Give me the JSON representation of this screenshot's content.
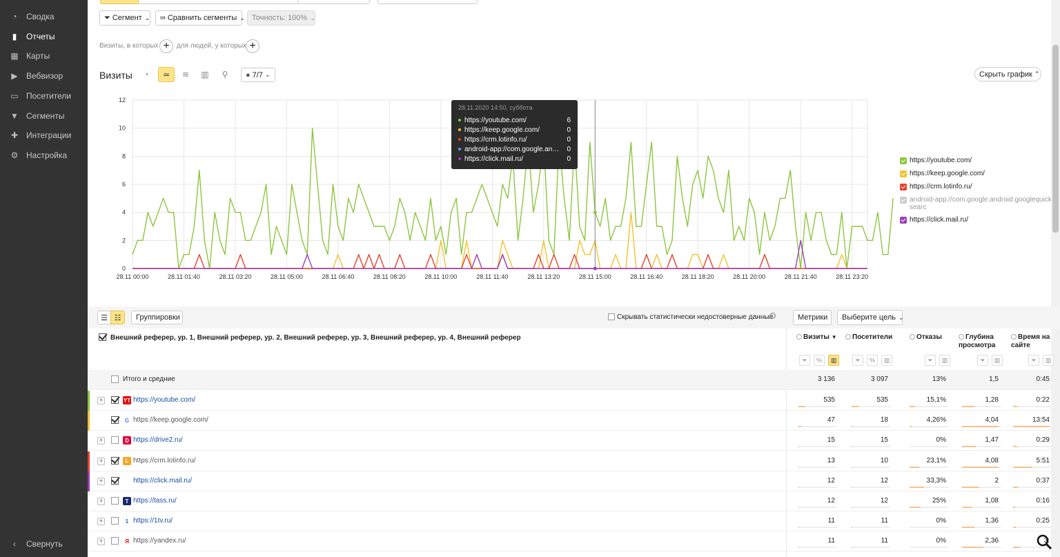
{
  "sidebar": {
    "items": [
      {
        "label": "Сводка",
        "icon": "gauge-icon",
        "active": false
      },
      {
        "label": "Отчеты",
        "icon": "bar-chart-icon",
        "active": true
      },
      {
        "label": "Карты",
        "icon": "map-icon",
        "active": false
      },
      {
        "label": "Вебвизор",
        "icon": "play-icon",
        "active": false
      },
      {
        "label": "Посетители",
        "icon": "visitors-icon",
        "active": false
      },
      {
        "label": "Сегменты",
        "icon": "funnel-icon",
        "active": false
      },
      {
        "label": "Интеграции",
        "icon": "puzzle-icon",
        "active": false
      },
      {
        "label": "Настройка",
        "icon": "gear-icon",
        "active": false
      }
    ],
    "collapse_label": "Свернуть"
  },
  "toolbar": {
    "segment_label": "Сегмент",
    "compare_label": "Сравнить сегменты",
    "accuracy_label": "Точность: 100%",
    "filter_visits_label": "Визиты, в которых",
    "filter_people_label": "для людей, у которых"
  },
  "chart_panel": {
    "title": "Визиты",
    "series_counter": "7/7",
    "hide_chart_label": "Скрыть график"
  },
  "tooltip": {
    "header": "28.11.2020 14:50, суббота",
    "rows": [
      {
        "label": "https://youtube.com/",
        "value": "6",
        "color": "#8cc63f"
      },
      {
        "label": "https://keep.google.com/",
        "value": "0",
        "color": "#f2c230"
      },
      {
        "label": "https://crm.lotinfo.ru/",
        "value": "0",
        "color": "#e8412c"
      },
      {
        "label": "android-app://com.google.andr...",
        "value": "0",
        "color": "#5aa0e0"
      },
      {
        "label": "https://click.mail.ru/",
        "value": "0",
        "color": "#9b3fb5"
      }
    ]
  },
  "legend": [
    {
      "label": "https://youtube.com/",
      "color": "#8cc63f"
    },
    {
      "label": "https://keep.google.com/",
      "color": "#f2c230"
    },
    {
      "label": "https://crm.lotinfo.ru/",
      "color": "#e8412c"
    },
    {
      "label": "android-app://com.google.android.googlequicksearc",
      "color": "#cccccc",
      "muted": true
    },
    {
      "label": "https://click.mail.ru/",
      "color": "#9b3fb5"
    }
  ],
  "chart_data": {
    "type": "line",
    "x_ticks": [
      "28.11 00:00",
      "28.11 01:40",
      "28.11 03:20",
      "28.11 05:00",
      "28.11 06:40",
      "28.11 08:20",
      "28.11 10:00",
      "28.11 11:40",
      "28.11 13:20",
      "28.11 15:00",
      "28.11 16:40",
      "28.11 18:20",
      "28.11 20:00",
      "28.11 21:40",
      "28.11 23:20"
    ],
    "ylim": [
      0,
      12
    ],
    "y_ticks": [
      0,
      2,
      4,
      6,
      8,
      10,
      12
    ],
    "x_count": 144,
    "series": [
      {
        "name": "https://youtube.com/",
        "color": "#8cc63f",
        "values": [
          1,
          2,
          2,
          4,
          3,
          4,
          5,
          4,
          4,
          0,
          1,
          1,
          3,
          7,
          2,
          0,
          4,
          2,
          1,
          5,
          4,
          4,
          2,
          2,
          3,
          4,
          6,
          1,
          3,
          2,
          1,
          6,
          4,
          2,
          1,
          10,
          6,
          2,
          1,
          6,
          3,
          2,
          5,
          4,
          6,
          5,
          4,
          3,
          3,
          3,
          2,
          3,
          5,
          4,
          2,
          4,
          3,
          2,
          5,
          2,
          3,
          1,
          4,
          5,
          1,
          4,
          4,
          5,
          6,
          5,
          4,
          3,
          6,
          5,
          8,
          2,
          5,
          9,
          4,
          6,
          9,
          2,
          1,
          9,
          5,
          2,
          9,
          3,
          2,
          9,
          4,
          3,
          5,
          2,
          3,
          3,
          5,
          9,
          3,
          3,
          6,
          9,
          3,
          3,
          1,
          2,
          8,
          5,
          3,
          6,
          7,
          5,
          8,
          7,
          5,
          4,
          7,
          2,
          3,
          2,
          5,
          4,
          1,
          4,
          2,
          3,
          5,
          5,
          7,
          3,
          0,
          4,
          2,
          4,
          4,
          2,
          1,
          1,
          4,
          0,
          3,
          3,
          3,
          2,
          2,
          4,
          1,
          1,
          5
        ]
      },
      {
        "name": "https://keep.google.com/",
        "color": "#f2c230",
        "values": [
          0,
          0,
          0,
          0,
          0,
          0,
          0,
          0,
          0,
          0,
          0,
          0,
          0,
          0,
          0,
          0,
          0,
          0,
          0,
          0,
          0,
          0,
          0,
          0,
          0,
          0,
          0,
          0,
          0,
          0,
          0,
          0,
          0,
          0,
          0,
          0,
          0,
          0,
          0,
          0,
          1,
          0,
          0,
          0,
          0,
          0,
          0,
          0,
          0,
          0,
          0,
          0,
          0,
          0,
          0,
          0,
          0,
          0,
          0,
          0,
          2,
          0,
          0,
          0,
          0,
          2,
          0,
          0,
          0,
          0,
          0,
          0,
          2,
          1,
          0,
          0,
          0,
          0,
          0,
          0,
          2,
          0,
          0,
          0,
          0,
          0,
          0,
          2,
          1,
          1,
          2,
          0,
          0,
          0,
          1,
          0,
          0,
          4,
          0,
          0,
          0,
          0,
          1,
          0,
          0,
          0,
          0,
          0,
          0,
          1,
          1,
          0,
          0,
          0,
          0,
          1,
          0,
          0,
          0,
          0,
          0,
          0,
          0,
          0,
          0,
          0,
          0,
          0,
          0,
          0,
          0,
          0,
          0,
          0,
          0,
          0,
          0,
          0,
          1,
          0,
          0,
          0,
          0,
          0
        ]
      },
      {
        "name": "https://crm.lotinfo.ru/",
        "color": "#e8412c",
        "values": [
          0,
          0,
          0,
          0,
          0,
          0,
          0,
          0,
          0,
          0,
          0,
          0,
          0,
          1,
          0,
          0,
          0,
          0,
          0,
          0,
          0,
          1,
          0,
          0,
          0,
          0,
          0,
          0,
          0,
          0,
          0,
          0,
          0,
          0,
          0,
          0,
          0,
          0,
          0,
          0,
          0,
          0,
          0,
          0,
          1,
          0,
          1,
          0,
          1,
          0,
          0,
          0,
          1,
          0,
          0,
          0,
          0,
          0,
          1,
          0,
          0,
          0,
          0,
          0,
          0,
          1,
          0,
          0,
          0,
          0,
          0,
          0,
          1,
          0,
          0,
          0,
          0,
          0,
          0,
          1,
          0,
          0,
          1,
          0,
          0,
          0,
          1,
          0,
          0,
          0,
          0,
          0,
          0,
          0,
          0,
          0,
          0,
          0,
          0,
          0,
          1,
          0,
          0,
          0,
          0,
          1,
          0,
          0,
          0,
          0,
          0,
          0,
          1,
          0,
          0,
          0,
          0,
          0,
          0,
          0,
          0,
          0,
          0,
          1,
          0,
          0,
          0,
          0,
          0,
          0,
          0,
          0,
          0,
          0,
          0,
          0,
          0,
          0,
          0,
          0,
          0,
          0,
          0,
          0
        ]
      },
      {
        "name": "https://click.mail.ru/",
        "color": "#9b3fb5",
        "values": [
          0,
          0,
          0,
          0,
          0,
          0,
          0,
          0,
          0,
          0,
          0,
          0,
          0,
          0,
          0,
          0,
          0,
          0,
          0,
          0,
          0,
          0,
          0,
          0,
          0,
          0,
          0,
          0,
          0,
          0,
          0,
          0,
          0,
          0,
          1,
          0,
          0,
          0,
          0,
          0,
          0,
          0,
          0,
          0,
          0,
          0,
          0,
          0,
          0,
          0,
          0,
          0,
          0,
          0,
          0,
          0,
          0,
          0,
          0,
          0,
          0,
          0,
          0,
          0,
          0,
          0,
          0,
          1,
          0,
          0,
          0,
          0,
          1,
          0,
          0,
          0,
          0,
          0,
          0,
          0,
          0,
          0,
          0,
          0,
          0,
          0,
          0,
          0,
          0,
          0,
          0,
          0,
          0,
          0,
          0,
          0,
          0,
          0,
          0,
          0,
          0,
          0,
          0,
          0,
          0,
          0,
          0,
          0,
          0,
          0,
          0,
          0,
          0,
          0,
          0,
          0,
          0,
          0,
          0,
          0,
          0,
          0,
          0,
          0,
          0,
          0,
          0,
          0,
          0,
          0,
          2,
          0,
          0,
          0,
          0,
          0,
          0,
          0,
          0,
          0,
          0,
          0,
          0,
          0
        ]
      }
    ]
  },
  "table_toolbar": {
    "groupings_label": "Группировки",
    "hide_unreliable_label": "Скрывать статистически недостоверные данные",
    "metrics_label": "Метрики",
    "goal_label": "Выберите цель"
  },
  "table": {
    "dimension_header": "Внешний реферер, ур. 1, Внешний реферер, ур. 2, Внешний реферер, ур. 3, Внешний реферер, ур. 4, Внешний реферер",
    "columns": [
      {
        "label": "Визиты",
        "sorted": "▼"
      },
      {
        "label": "Посетители"
      },
      {
        "label": "Отказы"
      },
      {
        "label": "Глубина просмотра"
      },
      {
        "label": "Время на сайте"
      }
    ],
    "total": {
      "label": "Итого и средние",
      "values": [
        "3 136",
        "3 097",
        "13%",
        "1,5",
        "0:45"
      ]
    },
    "rows": [
      {
        "name": "https://youtube.com/",
        "checked": true,
        "expandable": true,
        "color": "#8cc63f",
        "fav": "YT",
        "fav_bg": "#e00",
        "fav_fg": "#fff",
        "link": true,
        "values": [
          "535",
          "535",
          "15,1%",
          "1,28",
          "0:22"
        ],
        "bars": [
          0.17,
          0.17,
          0.15,
          0.32,
          0.1
        ]
      },
      {
        "name": "https://keep.google.com/",
        "checked": true,
        "expandable": false,
        "color": "#f2c230",
        "fav": "G",
        "fav_bg": "#fff",
        "fav_fg": "#4285f4",
        "link": false,
        "values": [
          "47",
          "18",
          "4,26%",
          "4,04",
          "13:54"
        ],
        "bars": [
          0.08,
          0.03,
          0.05,
          0.95,
          0.95
        ]
      },
      {
        "name": "https://drive2.ru/",
        "checked": false,
        "expandable": true,
        "color": "",
        "fav": "D",
        "fav_bg": "#e0003c",
        "fav_fg": "#fff",
        "link": true,
        "values": [
          "15",
          "15",
          "0%",
          "1,47",
          "0:29"
        ],
        "bars": [
          0.02,
          0.02,
          0.0,
          0.35,
          0.1
        ]
      },
      {
        "name": "https://crm.lotinfo.ru/",
        "checked": true,
        "expandable": true,
        "color": "#e8412c",
        "fav": "L",
        "fav_bg": "#f5a623",
        "fav_fg": "#fff",
        "link": false,
        "values": [
          "13",
          "10",
          "23,1%",
          "4,08",
          "5:51"
        ],
        "bars": [
          0.02,
          0.02,
          0.25,
          0.95,
          0.5
        ]
      },
      {
        "name": "https://click.mail.ru/",
        "checked": true,
        "expandable": true,
        "color": "#9b3fb5",
        "fav": "",
        "fav_bg": "#fff",
        "fav_fg": "#fff",
        "link": true,
        "values": [
          "12",
          "12",
          "33,3%",
          "2",
          "0:37"
        ],
        "bars": [
          0.02,
          0.02,
          0.38,
          0.45,
          0.12
        ]
      },
      {
        "name": "https://tass.ru/",
        "checked": false,
        "expandable": true,
        "color": "",
        "fav": "T",
        "fav_bg": "#1a2a6c",
        "fav_fg": "#fff",
        "link": true,
        "values": [
          "12",
          "12",
          "25%",
          "1,08",
          "0:16"
        ],
        "bars": [
          0.02,
          0.02,
          0.28,
          0.25,
          0.06
        ]
      },
      {
        "name": "https://1tv.ru/",
        "checked": false,
        "expandable": true,
        "color": "",
        "fav": "1",
        "fav_bg": "#fff",
        "fav_fg": "#1f6fc5",
        "link": true,
        "values": [
          "11",
          "11",
          "0%",
          "1,36",
          "0:25"
        ],
        "bars": [
          0.02,
          0.02,
          0.0,
          0.32,
          0.08
        ]
      },
      {
        "name": "https://yandex.ru/",
        "checked": false,
        "expandable": true,
        "color": "",
        "fav": "Я",
        "fav_bg": "#fff",
        "fav_fg": "#e00",
        "link": false,
        "values": [
          "11",
          "11",
          "0%",
          "2,36",
          "3:"
        ],
        "bars": [
          0.02,
          0.02,
          0.0,
          0.55,
          0.2
        ]
      }
    ]
  }
}
